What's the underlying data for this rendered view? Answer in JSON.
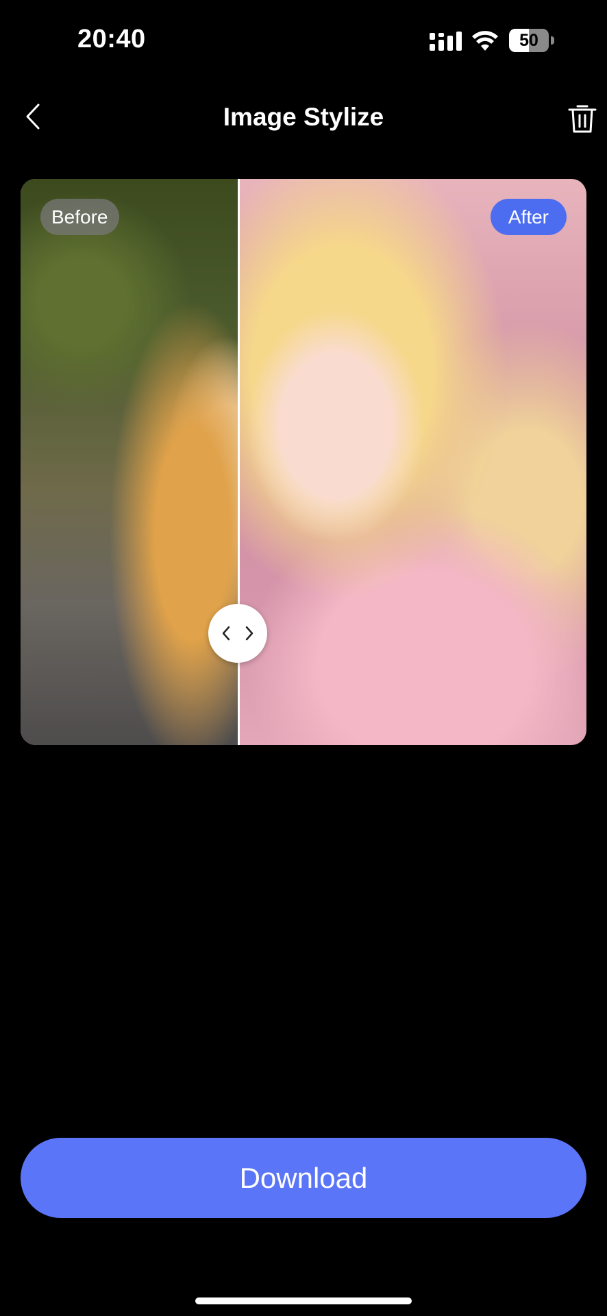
{
  "status_bar": {
    "time": "20:40",
    "battery_level": "50",
    "icons": [
      "signal-icon",
      "wifi-icon",
      "battery-icon"
    ]
  },
  "header": {
    "title": "Image Stylize",
    "back_icon": "chevron-left-icon",
    "delete_icon": "trash-icon"
  },
  "compare": {
    "before_label": "Before",
    "after_label": "After",
    "handle_icon": "left-right-arrows-icon"
  },
  "actions": {
    "download_label": "Download"
  },
  "colors": {
    "background": "#000000",
    "accent": "#5a75f7",
    "after_badge": "#4d6df0"
  }
}
